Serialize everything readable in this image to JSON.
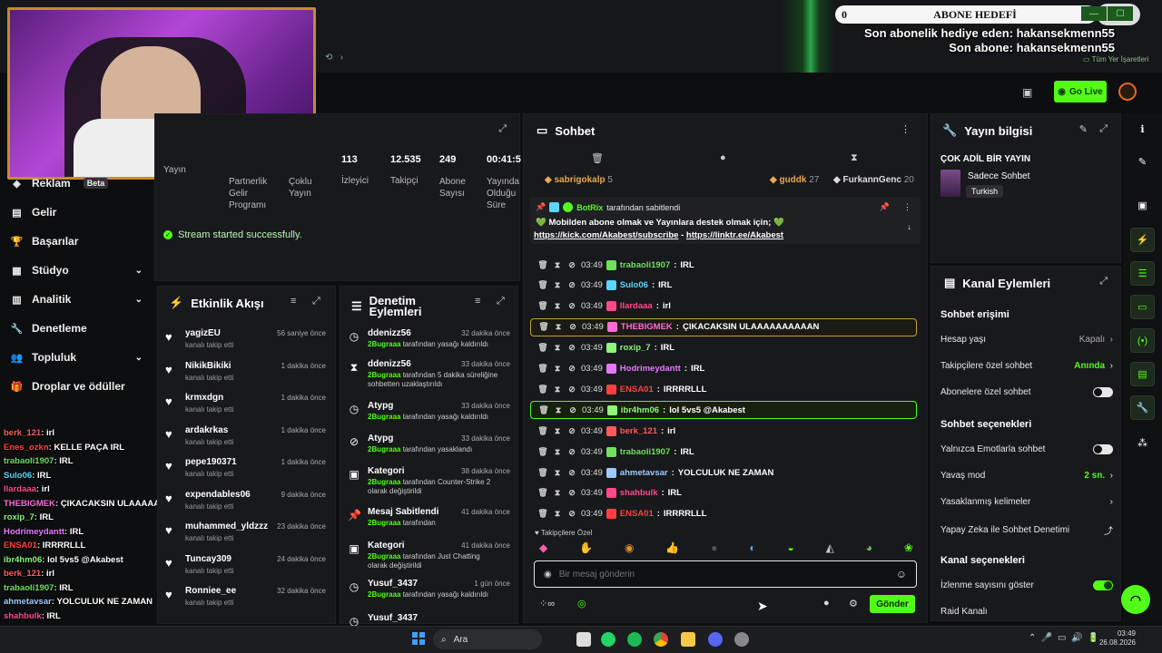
{
  "overlay": {
    "goal_left": "0",
    "goal_title": "ABONE HEDEFİ",
    "goal_right": "25",
    "last_gift": "Son abonelik hediye eden: hakansekmenn55",
    "last_sub": "Son abone: hakansekmenn55",
    "bookmarks": "Tüm Yer İşaretleri"
  },
  "header": {
    "go_live": "Go Live"
  },
  "sidenav": [
    {
      "label": "Reklam",
      "badge": "Beta"
    },
    {
      "label": "Gelir"
    },
    {
      "label": "Başarılar"
    },
    {
      "label": "Stüdyo",
      "chevron": true
    },
    {
      "label": "Analitik",
      "chevron": true
    },
    {
      "label": "Denetleme"
    },
    {
      "label": "Topluluk",
      "chevron": true
    },
    {
      "label": "Droplar ve ödüller"
    }
  ],
  "overlay_chat": [
    {
      "user": "berk_121",
      "color": "#ff5b5b",
      "text": "irl"
    },
    {
      "user": "Enes_ozkn",
      "color": "#ff4040",
      "text": "KELLE PAÇA IRL"
    },
    {
      "user": "trabaoli1907",
      "color": "#6ee05b",
      "text": "IRL"
    },
    {
      "user": "Sulo06",
      "color": "#5bd6ff",
      "text": "IRL"
    },
    {
      "user": "llardaaa",
      "color": "#ff4a8a",
      "text": "irl"
    },
    {
      "user": "THEBIGMEK",
      "color": "#ff6ad5",
      "text": "ÇIKACAKSIN ULAAAAAAAAAAN"
    },
    {
      "user": "roxip_7",
      "color": "#8cf57a",
      "text": "IRL"
    },
    {
      "user": "Hodrimeydantt",
      "color": "#e678ff",
      "text": "IRL"
    },
    {
      "user": "ENSA01",
      "color": "#ff4040",
      "text": "IRRRRLLL"
    },
    {
      "user": "ibr4hm06",
      "color": "#8cf57a",
      "text": "lol 5vs5 @Akabest"
    },
    {
      "user": "berk_121",
      "color": "#ff5b5b",
      "text": "irl"
    },
    {
      "user": "trabaoli1907",
      "color": "#6ee05b",
      "text": "IRL"
    },
    {
      "user": "ahmetavsar",
      "color": "#9ecbff",
      "text": "YOLCULUK NE ZAMAN"
    },
    {
      "user": "shahbulk",
      "color": "#ff4a8a",
      "text": "IRL"
    },
    {
      "user": "ENSA01",
      "color": "#ff4040",
      "text": "IRRRRLLL"
    }
  ],
  "stats": [
    {
      "value": "",
      "label": "Yayın"
    },
    {
      "value": "",
      "label": "Partnerlik Gelir Programı"
    },
    {
      "value": "",
      "label": "Çoklu Yayın"
    },
    {
      "value": "113",
      "label": "İzleyici"
    },
    {
      "value": "12.535",
      "label": "Takipçi"
    },
    {
      "value": "249",
      "label": "Abone Sayısı"
    },
    {
      "value": "00:41:54",
      "label": "Yayında Olduğu Süre"
    }
  ],
  "success_msg": "Stream started successfully.",
  "activity": {
    "title": "Etkinlik Akışı",
    "items": [
      {
        "name": "yagizEU",
        "sub": "kanalı takip etti",
        "time": "56 saniye önce"
      },
      {
        "name": "NikikBikiki",
        "sub": "kanalı takip etti",
        "time": "1 dakika önce"
      },
      {
        "name": "krmxdgn",
        "sub": "kanalı takip etti",
        "time": "1 dakika önce"
      },
      {
        "name": "ardakrkas",
        "sub": "kanalı takip etti",
        "time": "1 dakika önce"
      },
      {
        "name": "pepe190371",
        "sub": "kanalı takip etti",
        "time": "1 dakika önce"
      },
      {
        "name": "expendables06",
        "sub": "kanalı takip etti",
        "time": "9 dakika önce"
      },
      {
        "name": "muhammed_yldzzz",
        "sub": "kanalı takip etti",
        "time": "23 dakika önce"
      },
      {
        "name": "Tuncay309",
        "sub": "kanalı takip etti",
        "time": "24 dakika önce"
      },
      {
        "name": "Ronniee_ee",
        "sub": "kanalı takip etti",
        "time": "32 dakika önce"
      }
    ]
  },
  "moderation": {
    "title": "Denetim Eylemleri",
    "items": [
      {
        "icon": "clock",
        "name": "ddenizz56",
        "actor": "2Bugraaa",
        "text": "tarafından yasağı kaldırıldı",
        "time": "32 dakika önce"
      },
      {
        "icon": "hourglass",
        "name": "ddenizz56",
        "actor": "2Bugraaa",
        "text": "tarafından 5 dakika süreliğine sohbetten uzaklaştırıldı",
        "time": "33 dakika önce"
      },
      {
        "icon": "clock",
        "name": "Atypg",
        "actor": "2Bugraaa",
        "text": "tarafından yasağı kaldırıldı",
        "time": "33 dakika önce"
      },
      {
        "icon": "ban",
        "name": "Atypg",
        "actor": "2Bugraaa",
        "text": "tarafından yasaklandı",
        "time": "33 dakika önce"
      },
      {
        "icon": "category",
        "name": "Kategori",
        "actor": "2Bugraaa",
        "text": "tarafından Counter-Strike 2 olarak değiştirildi",
        "time": "38 dakika önce"
      },
      {
        "icon": "pin",
        "name": "Mesaj Sabitlendi",
        "actor": "2Bugraaa",
        "text": "tarafından",
        "time": "41 dakika önce"
      },
      {
        "icon": "category",
        "name": "Kategori",
        "actor": "2Bugraaa",
        "text": "tarafından Just Chatting olarak değiştirildi",
        "time": "41 dakika önce"
      },
      {
        "icon": "clock",
        "name": "Yusuf_3437",
        "actor": "2Bugraaa",
        "text": "tarafından yasağı kaldırıldı",
        "time": "1 gün önce"
      },
      {
        "icon": "clock",
        "name": "Yusuf_3437",
        "actor": "",
        "text": "",
        "time": ""
      }
    ]
  },
  "chat": {
    "title": "Sohbet",
    "leaders": [
      {
        "name": "sabrigokalp",
        "count": "5"
      },
      {
        "name": "guddk",
        "count": "27"
      },
      {
        "name": "FurkannGenc",
        "count": "20"
      }
    ],
    "pinned": {
      "by": "BotRix",
      "by_suffix": "tarafından sabitlendi",
      "text": "Mobilden abone olmak ve Yayınlara destek olmak için;",
      "link1": "https://kick.com/Akabest/subscribe",
      "sep": "-",
      "link2": "https://linktr.ee/Akabest"
    },
    "messages": [
      {
        "time": "03:49",
        "user": "trabaoli1907",
        "color": "#6ee05b",
        "text": "IRL"
      },
      {
        "time": "03:49",
        "user": "Sulo06",
        "color": "#5bd6ff",
        "text": "IRL"
      },
      {
        "time": "03:49",
        "user": "llardaaa",
        "color": "#ff4a8a",
        "text": "irl"
      },
      {
        "time": "03:49",
        "user": "THEBIGMEK",
        "color": "#ff6ad5",
        "text": "ÇIKACAKSIN ULAAAAAAAAAAN",
        "hl": "y"
      },
      {
        "time": "03:49",
        "user": "roxip_7",
        "color": "#8cf57a",
        "text": "IRL"
      },
      {
        "time": "03:49",
        "user": "Hodrimeydantt",
        "color": "#e678ff",
        "text": "IRL"
      },
      {
        "time": "03:49",
        "user": "ENSA01",
        "color": "#ff4040",
        "text": "IRRRRLLL"
      },
      {
        "time": "03:49",
        "user": "ibr4hm06",
        "color": "#8cf57a",
        "text": "lol 5vs5 @Akabest",
        "hl": "g"
      },
      {
        "time": "03:49",
        "user": "berk_121",
        "color": "#ff5b5b",
        "text": "irl"
      },
      {
        "time": "03:49",
        "user": "trabaoli1907",
        "color": "#6ee05b",
        "text": "IRL"
      },
      {
        "time": "03:49",
        "user": "ahmetavsar",
        "color": "#9ecbff",
        "text": "YOLCULUK NE ZAMAN"
      },
      {
        "time": "03:49",
        "user": "shahbulk",
        "color": "#ff4a8a",
        "text": "IRL"
      },
      {
        "time": "03:49",
        "user": "ENSA01",
        "color": "#ff4040",
        "text": "IRRRRLLL"
      }
    ],
    "followers_only": "Takipçilere Özel",
    "input_placeholder": "Bir mesaj gönderin",
    "send": "Gönder"
  },
  "stream_info": {
    "title": "Yayın bilgisi",
    "stream_title": "ÇOK ADİL BİR YAYIN",
    "category": "Sadece Sohbet",
    "language": "Turkish"
  },
  "channel_actions": {
    "title": "Kanal Eylemleri",
    "sec1": "Sohbet erişimi",
    "account_age": "Hesap yaşı",
    "account_age_val": "Kapalı",
    "follower_only": "Takipçilere özel sohbet",
    "follower_only_val": "Anında",
    "sub_only": "Abonelere özel sohbet",
    "sec2": "Sohbet seçenekleri",
    "emote_only": "Yalnızca Emotlarla sohbet",
    "slow_mode": "Yavaş mod",
    "slow_mode_val": "2 sn.",
    "banned_words": "Yasaklanmış kelimeler",
    "ai_mod": "Yapay Zeka ile Sohbet Denetimi",
    "sec3": "Kanal seçenekleri",
    "show_viewers": "İzlenme sayısını göster",
    "raid": "Raid Kanalı"
  },
  "taskbar": {
    "search": "Ara",
    "time": "03:49",
    "date": "26.08.2026"
  },
  "colors": {
    "accent": "#53fc18",
    "panel": "#18191c"
  }
}
